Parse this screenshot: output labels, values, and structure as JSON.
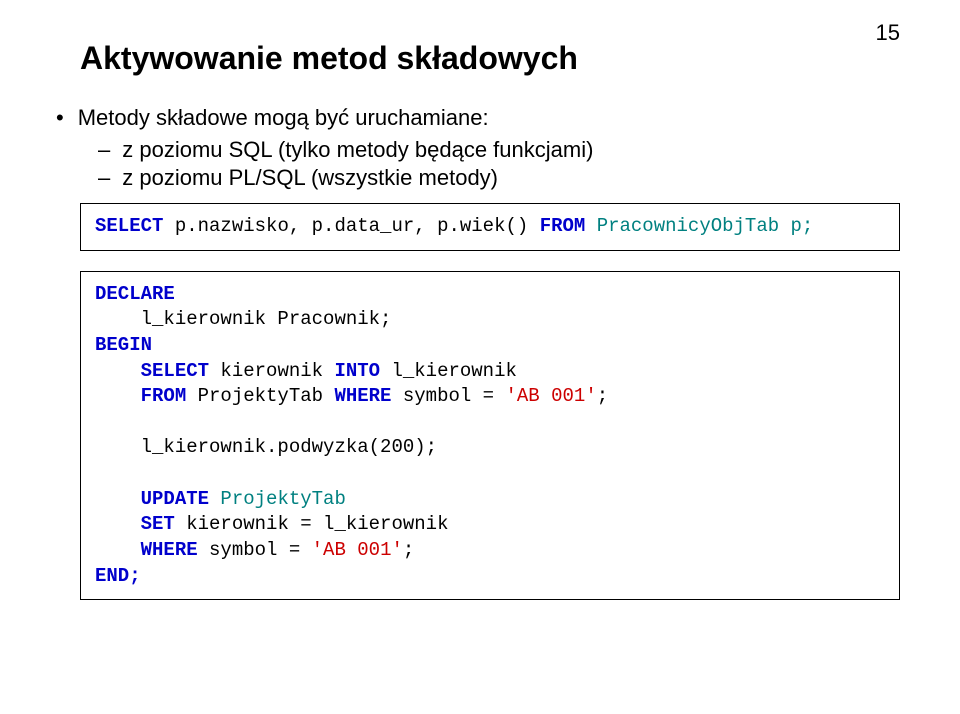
{
  "page_number": "15",
  "title": "Aktywowanie metod składowych",
  "bullet": {
    "main": "Metody składowe mogą być uruchamiane:",
    "subs": [
      "z poziomu SQL (tylko metody będące funkcjami)",
      "z poziomu PL/SQL (wszystkie metody)"
    ]
  },
  "code1": {
    "select": "SELECT",
    "cols": " p.nazwisko, p.data_ur, p.wiek() ",
    "from": "FROM",
    "tab": " PracownicyObjTab p;"
  },
  "code2": {
    "declare": "DECLARE",
    "var_line": "    l_kierownik Pracownik;",
    "begin": "BEGIN",
    "sel": "    SELECT",
    "sel_col": " kierownik ",
    "into": "INTO",
    "sel_var": " l_kierownik",
    "from": "    FROM",
    "from_tab": " ProjektyTab ",
    "where": "WHERE",
    "where_c1": " symbol = ",
    "str1": "'AB 001'",
    "semi": ";",
    "call": "    l_kierownik.podwyzka(200);",
    "update": "    UPDATE",
    "upd_tab": " ProjektyTab",
    "set": "    SET",
    "set_c": " kierownik = l_kierownik",
    "where2": "    WHERE",
    "where_c2": " symbol = ",
    "str2": "'AB 001'",
    "end": "END;"
  }
}
